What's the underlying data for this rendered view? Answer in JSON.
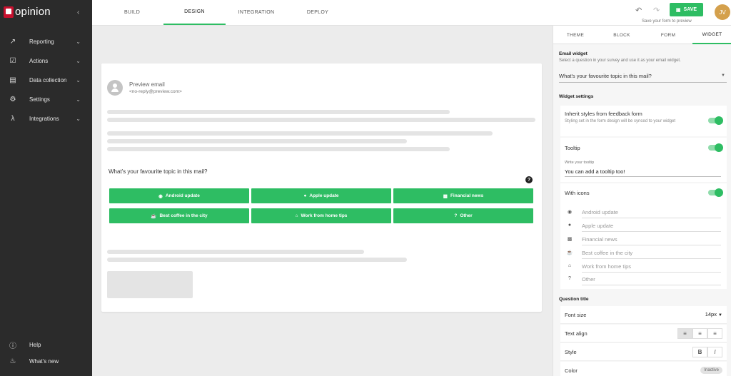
{
  "app": {
    "logo_letter": "m",
    "logo_text": "opinion"
  },
  "sidebar": {
    "items": [
      {
        "label": "Reporting",
        "icon": "trending-up-icon"
      },
      {
        "label": "Actions",
        "icon": "clipboard-check-icon"
      },
      {
        "label": "Data collection",
        "icon": "clipboard-icon"
      },
      {
        "label": "Settings",
        "icon": "gear-icon"
      },
      {
        "label": "Integrations",
        "icon": "integration-icon"
      }
    ],
    "bottom": [
      {
        "label": "Help",
        "icon": "help-circle-icon"
      },
      {
        "label": "What's new",
        "icon": "flame-icon"
      }
    ]
  },
  "topbar": {
    "tabs": [
      "BUILD",
      "DESIGN",
      "INTEGRATION",
      "DEPLOY"
    ],
    "active_tab": "DESIGN",
    "save_label": "SAVE",
    "save_hint": "Save your form to preview",
    "avatar_initials": "JV"
  },
  "preview": {
    "sender_name": "Preview email",
    "sender_email": "<no-reply@preview.com>",
    "question": "What's your favourite topic in this mail?",
    "help": "?",
    "options": [
      {
        "label": "Android update",
        "icon": "android-icon"
      },
      {
        "label": "Apple update",
        "icon": "apple-icon"
      },
      {
        "label": "Financial news",
        "icon": "bar-chart-icon"
      },
      {
        "label": "Best coffee in the city",
        "icon": "coffee-icon"
      },
      {
        "label": "Work from home tips",
        "icon": "home-icon"
      },
      {
        "label": "Other",
        "icon": "question-icon"
      }
    ]
  },
  "panel": {
    "tabs": [
      "THEME",
      "BLOCK",
      "FORM",
      "WIDGET"
    ],
    "active_tab": "WIDGET",
    "email_widget": {
      "title": "Email widget",
      "desc": "Select a question in your survey and use it as your email widget.",
      "selected": "What's your favourite topic in this mail?"
    },
    "widget_settings": {
      "title": "Widget settings",
      "inherit_label": "Inherit styles from feedback form",
      "inherit_desc": "Styling set in the form design will be synced to your widget",
      "tooltip_label": "Tooltip",
      "tooltip_field_label": "Write your tooltip",
      "tooltip_value": "You can add a tooltip too!",
      "with_icons_label": "With icons",
      "icon_options": [
        "Android update",
        "Apple update",
        "Financial news",
        "Best coffee in the city",
        "Work from home tips",
        "Other"
      ]
    },
    "question_title": {
      "title": "Question title",
      "font_size_label": "Font size",
      "font_size_value": "14px",
      "text_align_label": "Text align",
      "style_label": "Style",
      "style_bold": "B",
      "style_italic": "I",
      "color_label": "Color",
      "color_value": "Inactive"
    }
  },
  "colors": {
    "accent": "#2ebd63",
    "sidebar_bg": "#2b2b2b",
    "brand_red": "#c8102e"
  }
}
